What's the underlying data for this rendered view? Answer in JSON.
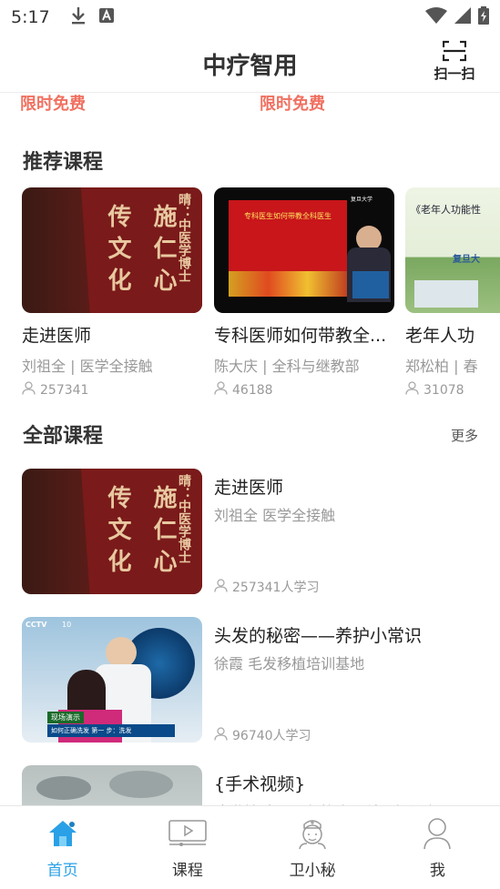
{
  "status_bar": {
    "time": "5:17"
  },
  "header": {
    "title": "中疗智用",
    "scan_label": "扫一扫"
  },
  "free_tags": [
    "限时免费",
    "限时免费"
  ],
  "recommended": {
    "title": "推荐课程",
    "items": [
      {
        "title": "走进医师",
        "sub": "刘祖全 | 医学全接触",
        "count": "257341"
      },
      {
        "title": "专科医师如何带教全...",
        "sub": "陈大庆 | 全科与继教部",
        "count": "46188"
      },
      {
        "title": "老年人功",
        "sub": "郑松柏 | 春",
        "count": "31078"
      }
    ]
  },
  "all_courses": {
    "title": "全部课程",
    "more": "更多",
    "items": [
      {
        "title": "走进医师",
        "sub": "刘祖全  医学全接触",
        "count": "257341人学习"
      },
      {
        "title": "头发的秘密——养护小常识",
        "sub": "徐霞  毛发移植培训基地",
        "count": "96740人学习"
      },
      {
        "title": "{手术视频}",
        "sub": "陈世益  中国医师协会骨科医师分会",
        "count": ""
      }
    ]
  },
  "thumbnail_text": {
    "book_col_1": "晴：中医学博士",
    "book_col_2": "传 文 化",
    "book_col_3": "施 仁 心",
    "slide_text": "专科医生如何带教全科医生",
    "slide_logo": "复旦大学",
    "elder_text": "《老年人功能性",
    "elder_logo": "复旦大",
    "tv_logo": "CCTV",
    "tv_channel": "10",
    "tv_banner": "现场演示",
    "tv_caption": "如何正确洗发  第一 步：洗发"
  },
  "tabs": [
    {
      "label": "首页",
      "icon": "home-icon",
      "active": true
    },
    {
      "label": "课程",
      "icon": "video-course-icon",
      "active": false
    },
    {
      "label": "卫小秘",
      "icon": "nurse-icon",
      "active": false
    },
    {
      "label": "我",
      "icon": "profile-icon",
      "active": false
    }
  ],
  "colors": {
    "accent": "#2aa0e6",
    "free_tag": "#f07060",
    "muted": "#999999"
  }
}
